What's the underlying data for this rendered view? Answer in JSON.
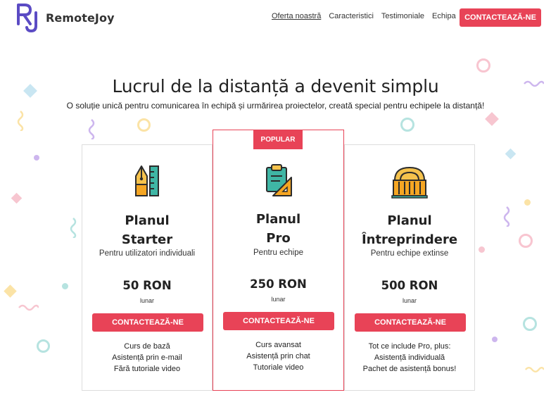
{
  "brand": {
    "name": "RemoteJoy",
    "mark_letters": "RJ"
  },
  "nav": {
    "items": [
      {
        "label": "Oferta noastră",
        "active": true
      },
      {
        "label": "Caracteristici",
        "active": false
      },
      {
        "label": "Testimoniale",
        "active": false
      },
      {
        "label": "Echipa",
        "active": false
      }
    ],
    "cta_label": "CONTACTEAZĂ-NE"
  },
  "hero": {
    "title": "Lucrul de la distanță a devenit simplu",
    "subtitle": "O soluție unică pentru comunicarea în echipă și urmărirea proiectelor, creată special pentru echipele la distanță!"
  },
  "plans": [
    {
      "title_line1": "Planul",
      "title_line2": "Starter",
      "subtitle": "Pentru utilizatori individuali",
      "price": "50 RON",
      "period": "lunar",
      "cta_label": "CONTACTEAZĂ-NE",
      "features": [
        "Curs de bază",
        "Asistență prin e-mail",
        "Fără tutoriale video"
      ],
      "icon": "pen-ruler-icon"
    },
    {
      "badge": "POPULAR",
      "title_line1": "Planul",
      "title_line2": "Pro",
      "subtitle": "Pentru echipe",
      "price": "250 RON",
      "period": "lunar",
      "cta_label": "CONTACTEAZĂ-NE",
      "features": [
        "Curs avansat",
        "Asistență prin chat",
        "Tutoriale video"
      ],
      "icon": "clipboard-ruler-icon"
    },
    {
      "title_line1": "Planul",
      "title_line2": "Întreprindere",
      "subtitle": "Pentru echipe extinse",
      "price": "500 RON",
      "period": "lunar",
      "cta_label": "CONTACTEAZĂ-NE",
      "features": [
        "Tot ce include Pro, plus:",
        "Asistență individuală",
        "Pachet de asistență bonus!"
      ],
      "icon": "building-icon"
    }
  ],
  "colors": {
    "accent": "#e84357",
    "brand_purple": "#5b4bc4",
    "confetti": [
      "#f7c6d0",
      "#b6e3e0",
      "#fbe3a6",
      "#cdb6ee",
      "#c9e7ee"
    ]
  }
}
